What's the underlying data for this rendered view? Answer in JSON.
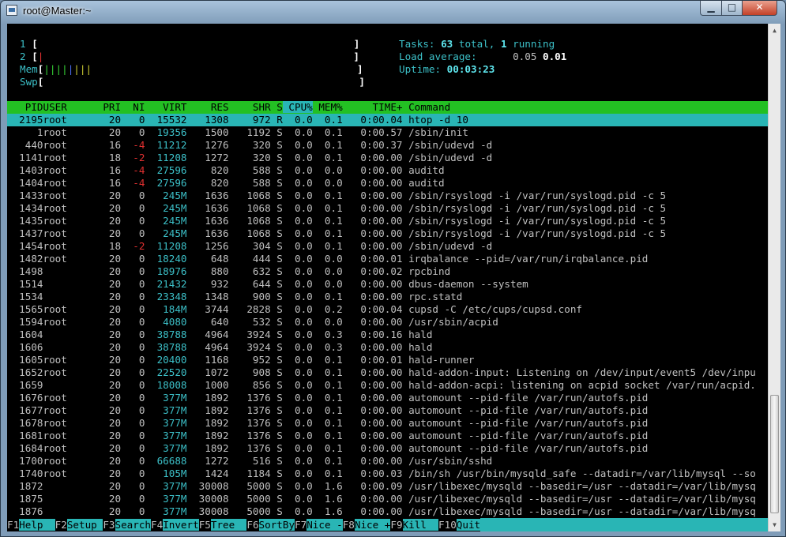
{
  "window": {
    "title": "root@Master:~"
  },
  "meters": {
    "cpu1_label": "1",
    "cpu2_label": "2",
    "mem_label": "Mem",
    "swp_label": "Swp",
    "open": "[",
    "close": "]",
    "cpu2_bar": "|",
    "mem_bar_green": "||||",
    "mem_bar_blue": "|",
    "mem_bar_yellow": "|||"
  },
  "summary": {
    "tasks_label": "Tasks:",
    "tasks_total": "63",
    "tasks_total_suffix": "total,",
    "tasks_running": "1",
    "tasks_running_suffix": "running",
    "load_label": "Load average:",
    "load_1": "0.05",
    "load_5": "0.01",
    "uptime_label": "Uptime:",
    "uptime": "00:03:23"
  },
  "columns": [
    "PID",
    "USER",
    "PRI",
    "NI",
    "VIRT",
    "RES",
    "SHR",
    "S",
    "CPU%",
    "MEM%",
    "TIME+",
    "Command"
  ],
  "processes": [
    [
      "2195",
      "root",
      "20",
      "0",
      "15532",
      "1308",
      "972",
      "R",
      "0.0",
      "0.1",
      "0:00.04",
      "htop -d 10"
    ],
    [
      "1",
      "root",
      "20",
      "0",
      "19356",
      "1500",
      "1192",
      "S",
      "0.0",
      "0.1",
      "0:00.57",
      "/sbin/init"
    ],
    [
      "440",
      "root",
      "16",
      "-4",
      "11212",
      "1276",
      "320",
      "S",
      "0.0",
      "0.1",
      "0:00.37",
      "/sbin/udevd -d"
    ],
    [
      "1141",
      "root",
      "18",
      "-2",
      "11208",
      "1272",
      "320",
      "S",
      "0.0",
      "0.1",
      "0:00.00",
      "/sbin/udevd -d"
    ],
    [
      "1403",
      "root",
      "16",
      "-4",
      "27596",
      "820",
      "588",
      "S",
      "0.0",
      "0.0",
      "0:00.00",
      "auditd"
    ],
    [
      "1404",
      "root",
      "16",
      "-4",
      "27596",
      "820",
      "588",
      "S",
      "0.0",
      "0.0",
      "0:00.00",
      "auditd"
    ],
    [
      "1433",
      "root",
      "20",
      "0",
      "245M",
      "1636",
      "1068",
      "S",
      "0.0",
      "0.1",
      "0:00.00",
      "/sbin/rsyslogd -i /var/run/syslogd.pid -c 5"
    ],
    [
      "1434",
      "root",
      "20",
      "0",
      "245M",
      "1636",
      "1068",
      "S",
      "0.0",
      "0.1",
      "0:00.00",
      "/sbin/rsyslogd -i /var/run/syslogd.pid -c 5"
    ],
    [
      "1435",
      "root",
      "20",
      "0",
      "245M",
      "1636",
      "1068",
      "S",
      "0.0",
      "0.1",
      "0:00.00",
      "/sbin/rsyslogd -i /var/run/syslogd.pid -c 5"
    ],
    [
      "1437",
      "root",
      "20",
      "0",
      "245M",
      "1636",
      "1068",
      "S",
      "0.0",
      "0.1",
      "0:00.00",
      "/sbin/rsyslogd -i /var/run/syslogd.pid -c 5"
    ],
    [
      "1454",
      "root",
      "18",
      "-2",
      "11208",
      "1256",
      "304",
      "S",
      "0.0",
      "0.1",
      "0:00.00",
      "/sbin/udevd -d"
    ],
    [
      "1482",
      "root",
      "20",
      "0",
      "18240",
      "648",
      "444",
      "S",
      "0.0",
      "0.0",
      "0:00.01",
      "irqbalance --pid=/var/run/irqbalance.pid"
    ],
    [
      "1498",
      "",
      "20",
      "0",
      "18976",
      "880",
      "632",
      "S",
      "0.0",
      "0.0",
      "0:00.02",
      "rpcbind"
    ],
    [
      "1514",
      "",
      "20",
      "0",
      "21432",
      "932",
      "644",
      "S",
      "0.0",
      "0.0",
      "0:00.00",
      "dbus-daemon --system"
    ],
    [
      "1534",
      "",
      "20",
      "0",
      "23348",
      "1348",
      "900",
      "S",
      "0.0",
      "0.1",
      "0:00.00",
      "rpc.statd"
    ],
    [
      "1565",
      "root",
      "20",
      "0",
      "184M",
      "3744",
      "2828",
      "S",
      "0.0",
      "0.2",
      "0:00.04",
      "cupsd -C /etc/cups/cupsd.conf"
    ],
    [
      "1594",
      "root",
      "20",
      "0",
      "4080",
      "640",
      "532",
      "S",
      "0.0",
      "0.0",
      "0:00.00",
      "/usr/sbin/acpid"
    ],
    [
      "1604",
      "",
      "20",
      "0",
      "38788",
      "4964",
      "3924",
      "S",
      "0.0",
      "0.3",
      "0:00.16",
      "hald"
    ],
    [
      "1606",
      "",
      "20",
      "0",
      "38788",
      "4964",
      "3924",
      "S",
      "0.0",
      "0.3",
      "0:00.00",
      "hald"
    ],
    [
      "1605",
      "root",
      "20",
      "0",
      "20400",
      "1168",
      "952",
      "S",
      "0.0",
      "0.1",
      "0:00.01",
      "hald-runner"
    ],
    [
      "1652",
      "root",
      "20",
      "0",
      "22520",
      "1072",
      "908",
      "S",
      "0.0",
      "0.1",
      "0:00.00",
      "hald-addon-input: Listening on /dev/input/event5 /dev/inpu"
    ],
    [
      "1659",
      "",
      "20",
      "0",
      "18008",
      "1000",
      "856",
      "S",
      "0.0",
      "0.1",
      "0:00.00",
      "hald-addon-acpi: listening on acpid socket /var/run/acpid."
    ],
    [
      "1676",
      "root",
      "20",
      "0",
      "377M",
      "1892",
      "1376",
      "S",
      "0.0",
      "0.1",
      "0:00.00",
      "automount --pid-file /var/run/autofs.pid"
    ],
    [
      "1677",
      "root",
      "20",
      "0",
      "377M",
      "1892",
      "1376",
      "S",
      "0.0",
      "0.1",
      "0:00.00",
      "automount --pid-file /var/run/autofs.pid"
    ],
    [
      "1678",
      "root",
      "20",
      "0",
      "377M",
      "1892",
      "1376",
      "S",
      "0.0",
      "0.1",
      "0:00.00",
      "automount --pid-file /var/run/autofs.pid"
    ],
    [
      "1681",
      "root",
      "20",
      "0",
      "377M",
      "1892",
      "1376",
      "S",
      "0.0",
      "0.1",
      "0:00.00",
      "automount --pid-file /var/run/autofs.pid"
    ],
    [
      "1684",
      "root",
      "20",
      "0",
      "377M",
      "1892",
      "1376",
      "S",
      "0.0",
      "0.1",
      "0:00.00",
      "automount --pid-file /var/run/autofs.pid"
    ],
    [
      "1700",
      "root",
      "20",
      "0",
      "66688",
      "1272",
      "516",
      "S",
      "0.0",
      "0.1",
      "0:00.00",
      "/usr/sbin/sshd"
    ],
    [
      "1740",
      "root",
      "20",
      "0",
      "105M",
      "1424",
      "1184",
      "S",
      "0.0",
      "0.1",
      "0:00.03",
      "/bin/sh /usr/bin/mysqld_safe --datadir=/var/lib/mysql --so"
    ],
    [
      "1872",
      "",
      "20",
      "0",
      "377M",
      "30008",
      "5000",
      "S",
      "0.0",
      "1.6",
      "0:00.09",
      "/usr/libexec/mysqld --basedir=/usr --datadir=/var/lib/mysq"
    ],
    [
      "1875",
      "",
      "20",
      "0",
      "377M",
      "30008",
      "5000",
      "S",
      "0.0",
      "1.6",
      "0:00.00",
      "/usr/libexec/mysqld --basedir=/usr --datadir=/var/lib/mysq"
    ],
    [
      "1876",
      "",
      "20",
      "0",
      "377M",
      "30008",
      "5000",
      "S",
      "0.0",
      "1.6",
      "0:00.00",
      "/usr/libexec/mysqld --basedir=/usr --datadir=/var/lib/mysq"
    ]
  ],
  "footer": [
    {
      "key": "F1",
      "label": "Help  "
    },
    {
      "key": "F2",
      "label": "Setup "
    },
    {
      "key": "F3",
      "label": "Search"
    },
    {
      "key": "F4",
      "label": "Invert"
    },
    {
      "key": "F5",
      "label": "Tree  "
    },
    {
      "key": "F6",
      "label": "SortBy"
    },
    {
      "key": "F7",
      "label": "Nice -"
    },
    {
      "key": "F8",
      "label": "Nice +"
    },
    {
      "key": "F9",
      "label": "Kill  "
    },
    {
      "key": "F10",
      "label": "Quit"
    }
  ],
  "colors": {
    "header_bg": "#23c023",
    "selection_bg": "#29b5b5",
    "terminal_bg": "#000000"
  }
}
